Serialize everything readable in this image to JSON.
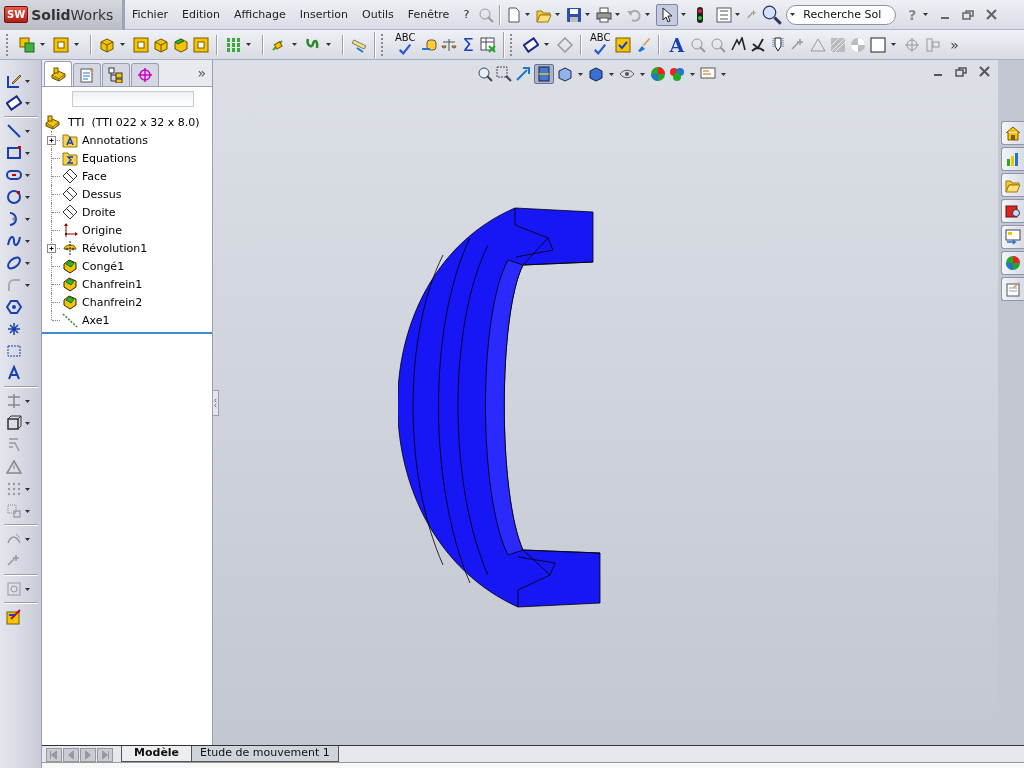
{
  "app": {
    "logo_mark": "SW",
    "name_bold": "Solid",
    "name_rest": "Works"
  },
  "menus": [
    "Fichier",
    "Edition",
    "Affichage",
    "Insertion",
    "Outils",
    "Fenêtre",
    "?"
  ],
  "search": {
    "placeholder": "Recherche Sol"
  },
  "help_button": "?",
  "toolbar": {
    "spellcheck_labels": [
      "ABC",
      "ABC"
    ],
    "sum_symbol": "Σ",
    "text_symbol": "A",
    "overflow": "»"
  },
  "panel": {
    "tabs": [
      {
        "selected": true
      },
      {
        "selected": false
      },
      {
        "selected": false
      },
      {
        "selected": false
      }
    ],
    "overflow": "»"
  },
  "tree": {
    "root": "TTI  (TTI 022 x 32 x 8.0)",
    "items": [
      {
        "label": "Annotations",
        "kind": "annotations",
        "expandable": true
      },
      {
        "label": "Equations",
        "kind": "equations",
        "expandable": false
      },
      {
        "label": "Face",
        "kind": "plane",
        "expandable": false
      },
      {
        "label": "Dessus",
        "kind": "plane",
        "expandable": false
      },
      {
        "label": "Droite",
        "kind": "plane",
        "expandable": false
      },
      {
        "label": "Origine",
        "kind": "origin",
        "expandable": false
      },
      {
        "label": "Révolution1",
        "kind": "revolve",
        "expandable": true
      },
      {
        "label": "Congé1",
        "kind": "feature",
        "expandable": false
      },
      {
        "label": "Chanfrein1",
        "kind": "feature",
        "expandable": false
      },
      {
        "label": "Chanfrein2",
        "kind": "feature",
        "expandable": false
      },
      {
        "label": "Axe1",
        "kind": "axis",
        "expandable": false
      }
    ]
  },
  "bottom_tabs": [
    {
      "label": "Modèle",
      "selected": true
    },
    {
      "label": "Etude de mouvement 1",
      "selected": false
    }
  ]
}
